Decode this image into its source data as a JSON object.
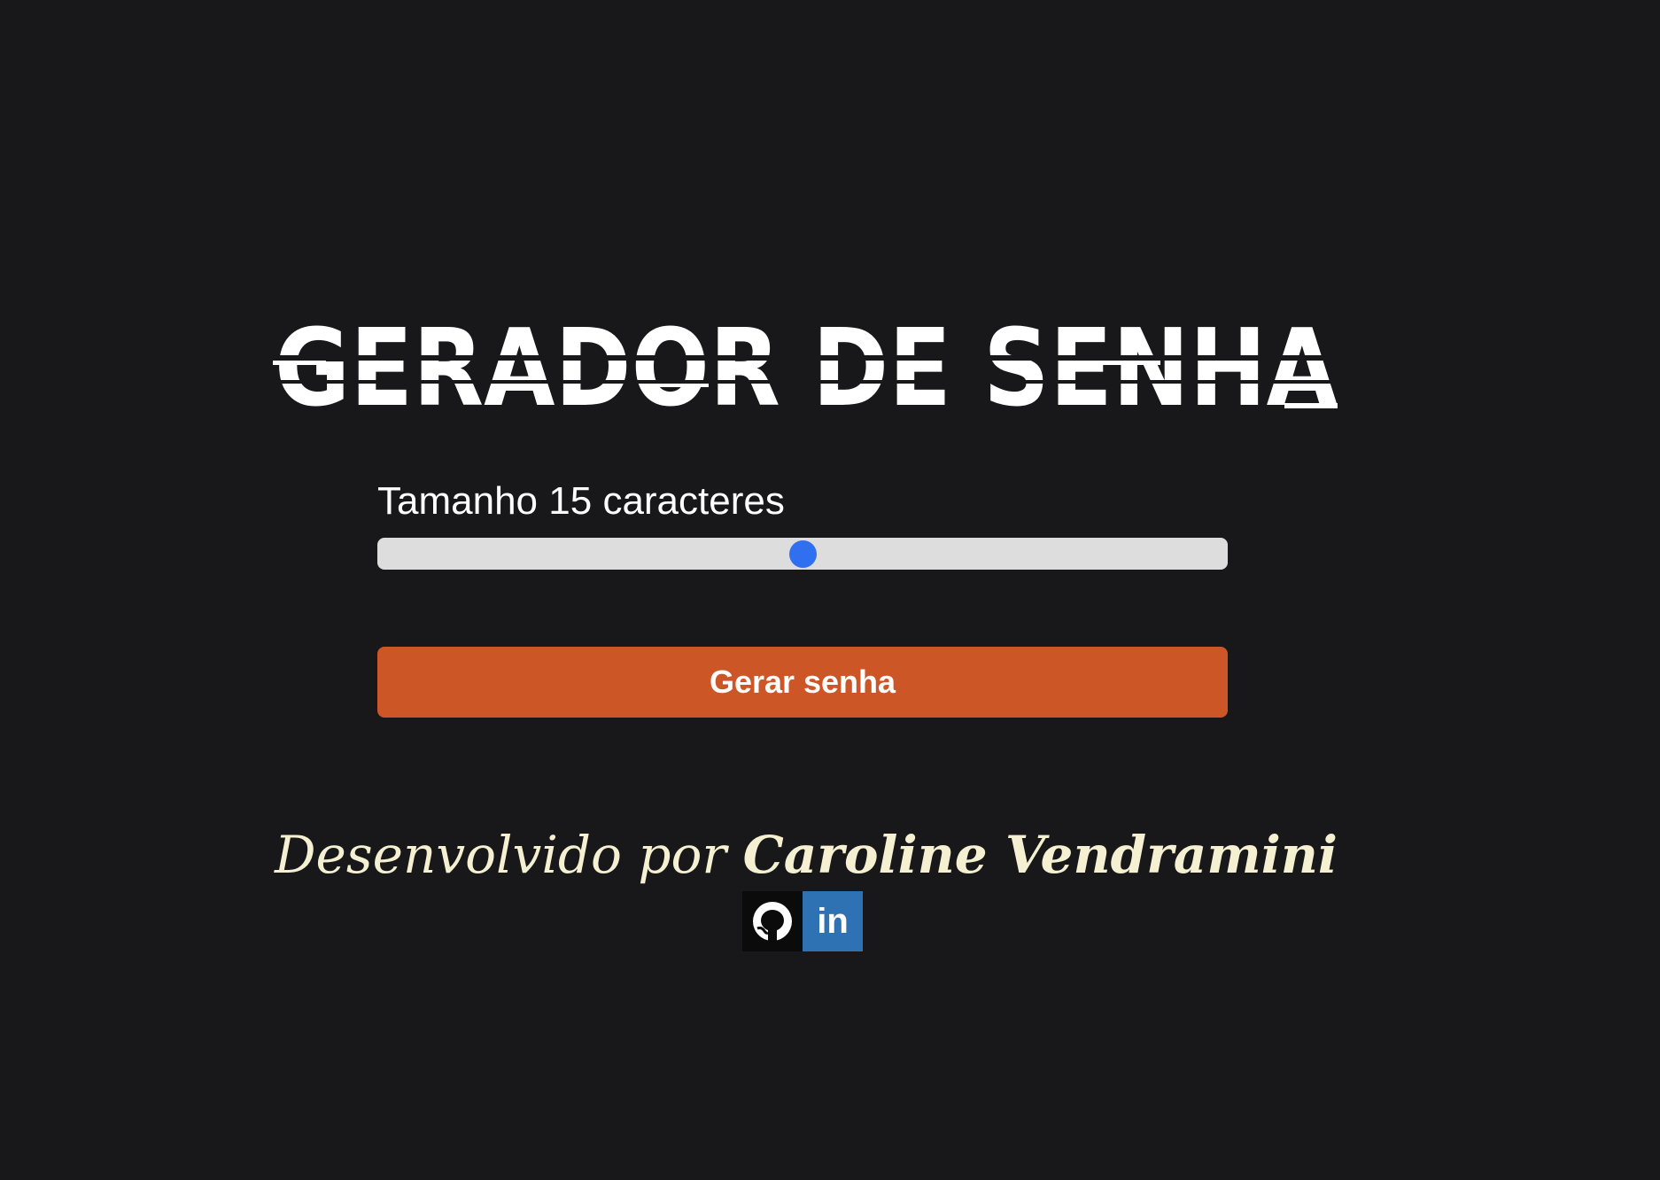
{
  "header": {
    "title": "GERADOR DE SENHA"
  },
  "length_control": {
    "label_prefix": "Tamanho",
    "value": 15,
    "label_suffix": "caracteres",
    "slider_fraction": 0.5
  },
  "actions": {
    "generate_label": "Gerar senha"
  },
  "footer": {
    "credit_prefix": "Desenvolvido por",
    "author_name": "Caroline Vendramini",
    "links": [
      {
        "icon": "github-icon"
      },
      {
        "icon": "linkedin-icon",
        "text": "in"
      }
    ]
  },
  "colors": {
    "background": "#18181a",
    "title": "#ffffff",
    "slider_track": "#dddddd",
    "slider_thumb": "#2f6ff0",
    "button": "#cc5626",
    "credit_text": "#f5f0d2",
    "github_bg": "#0b0b0c",
    "linkedin_bg": "#2f72b3"
  }
}
